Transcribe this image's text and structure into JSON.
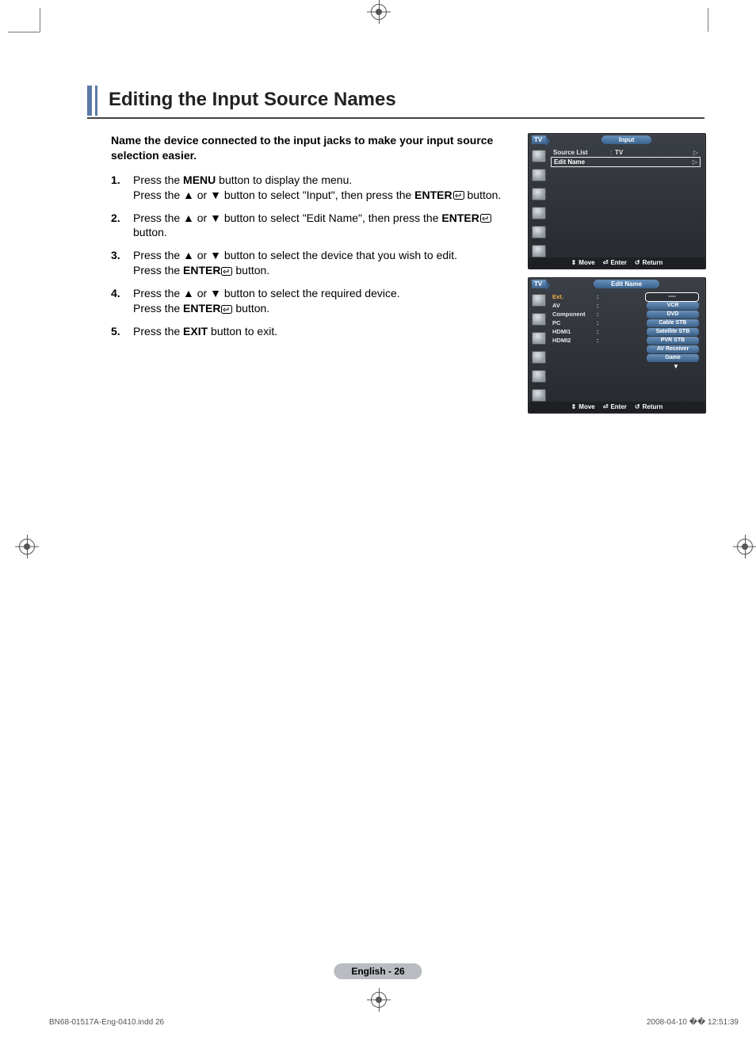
{
  "title": "Editing the Input Source Names",
  "intro": "Name the device connected to the input jacks to make your input source selection easier.",
  "steps": [
    {
      "pre": "Press the ",
      "bold1": "MENU",
      "mid": " button to display the menu.\nPress the ▲ or ▼ button to select \"Input\", then press the ",
      "bold2": "ENTER",
      "post": " button."
    },
    {
      "pre": "Press the ▲ or ▼ button to select \"Edit Name\", then press the ",
      "bold1": "ENTER",
      "mid": " button.",
      "bold2": "",
      "post": ""
    },
    {
      "pre": "Press the ▲ or ▼ button to select the device that you wish to edit.\nPress the ",
      "bold1": "ENTER",
      "mid": " button.",
      "bold2": "",
      "post": ""
    },
    {
      "pre": "Press the ▲ or ▼ button to select the required device.\nPress the ",
      "bold1": "ENTER",
      "mid": " button.",
      "bold2": "",
      "post": ""
    },
    {
      "pre": "Press the ",
      "bold1": "EXIT",
      "mid": " button to exit.",
      "bold2": "",
      "post": ""
    }
  ],
  "osd1": {
    "tv": "TV",
    "title": "Input",
    "rows": [
      {
        "label": "Source List",
        "val": "TV",
        "arrow": "▷",
        "selected": false
      },
      {
        "label": "Edit Name",
        "val": "",
        "arrow": "▷",
        "selected": true
      }
    ],
    "footer": {
      "move": "Move",
      "enter": "Enter",
      "return": "Return"
    }
  },
  "osd2": {
    "tv": "TV",
    "title": "Edit Name",
    "inputs": [
      "Ext.",
      "AV",
      "Component",
      "PC",
      "HDMI1",
      "HDMI2"
    ],
    "options": [
      "----",
      "VCR",
      "DVD",
      "Cable STB",
      "Satellite STB",
      "PVR STB",
      "AV Receiver",
      "Game"
    ],
    "footer": {
      "move": "Move",
      "enter": "Enter",
      "return": "Return"
    }
  },
  "pageFooter": "English - 26",
  "indd": {
    "file": "BN68-01517A-Eng-0410.indd   26",
    "stamp": "2008-04-10   �� 12:51:39"
  }
}
